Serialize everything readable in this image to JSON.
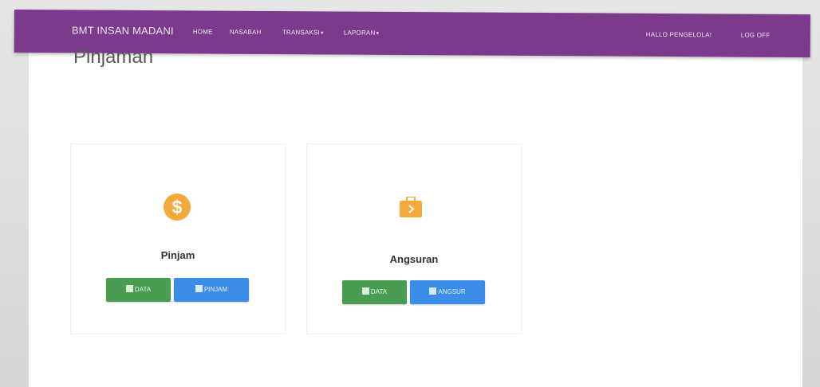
{
  "navbar": {
    "brand": "BMT INSAN MADANI",
    "links": [
      "HOME",
      "NASABAH",
      "TRANSAKSI",
      "LAPORAN"
    ],
    "dropdown_caret": "▾",
    "user_greeting": "HALLO PENGELOLA!",
    "logout": "LOG OFF",
    "color": "#7b3a8c"
  },
  "main": {
    "title": "Pinjaman",
    "cards": [
      {
        "icon": "dollar-circle-icon",
        "title": "Pinjam",
        "buttons": [
          {
            "label": "DATA",
            "color": "#4a9c52"
          },
          {
            "label": "PINJAM",
            "color": "#3c8de8"
          }
        ]
      },
      {
        "icon": "briefcase-arrow-icon",
        "title": "Angsuran",
        "buttons": [
          {
            "label": "DATA",
            "color": "#4a9c52"
          },
          {
            "label": "ANGSUR",
            "color": "#3c8de8"
          }
        ]
      }
    ]
  }
}
